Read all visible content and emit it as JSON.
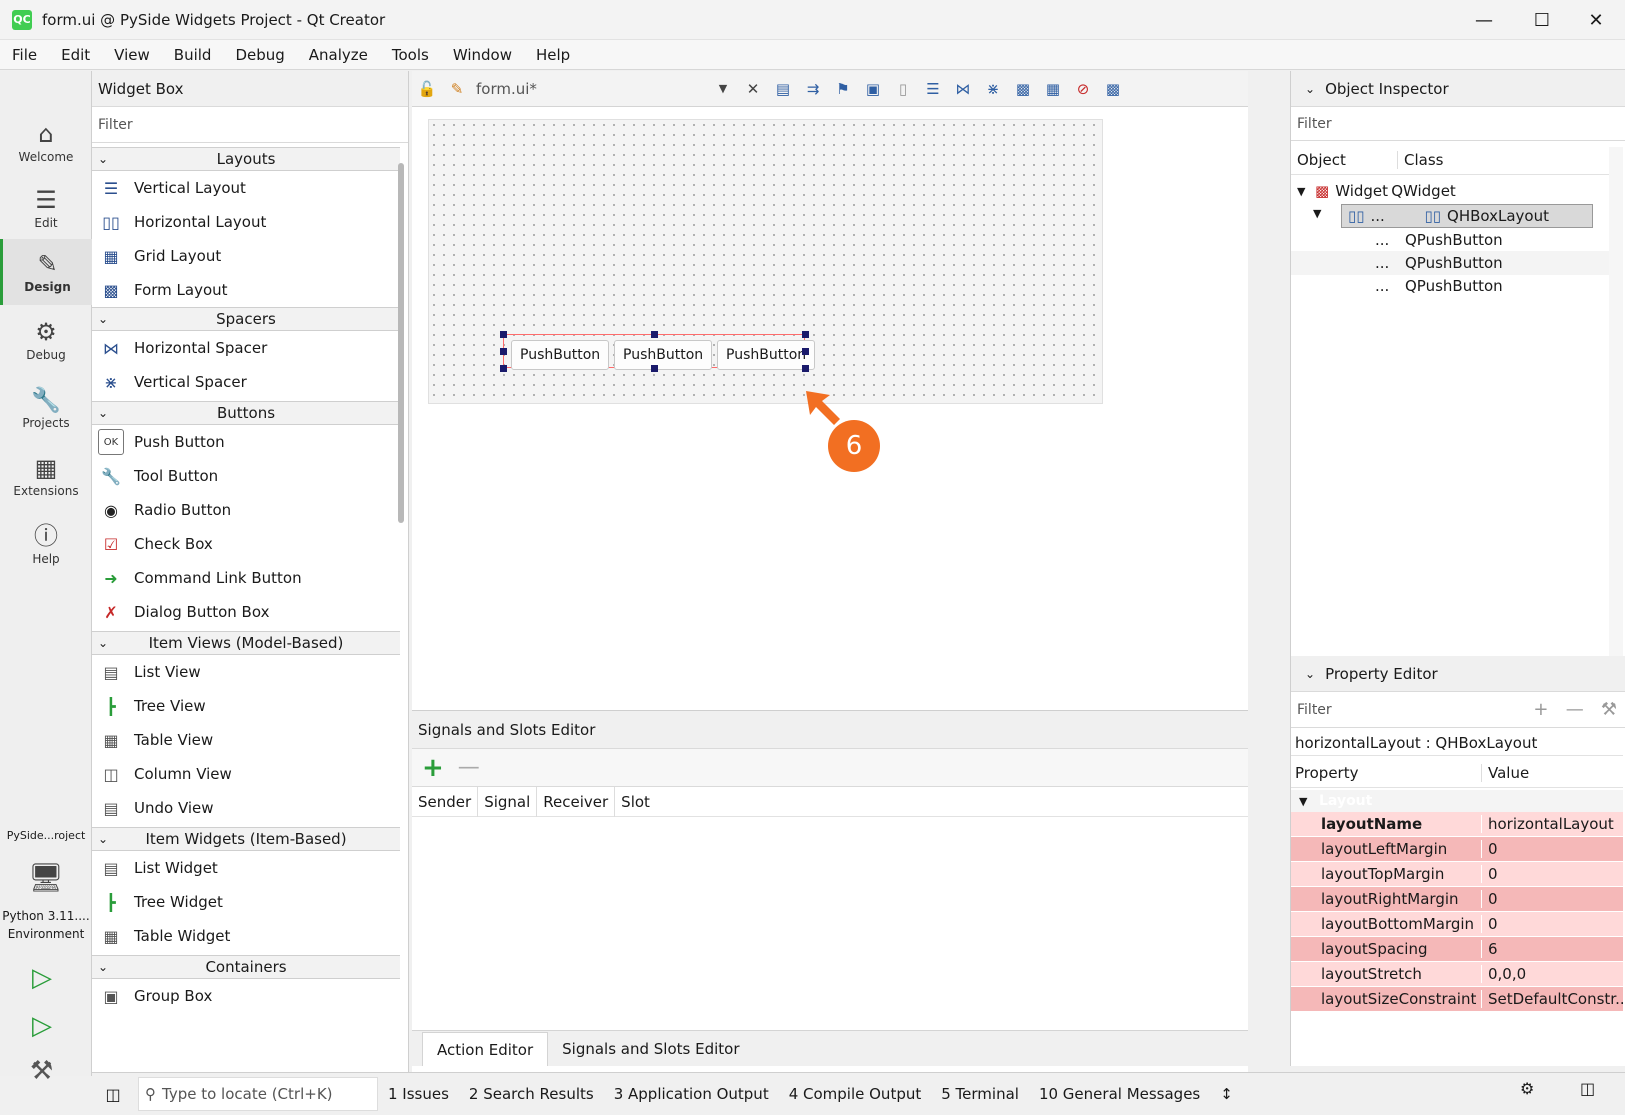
{
  "window": {
    "title": "form.ui @ PySide Widgets Project - Qt Creator",
    "app_icon": "QC"
  },
  "menu": [
    "File",
    "Edit",
    "View",
    "Build",
    "Debug",
    "Analyze",
    "Tools",
    "Window",
    "Help"
  ],
  "modes": [
    {
      "label": "Welcome",
      "icon": "home-icon"
    },
    {
      "label": "Edit",
      "icon": "edit-lines-icon"
    },
    {
      "label": "Design",
      "icon": "pen-icon",
      "active": true
    },
    {
      "label": "Debug",
      "icon": "bug-icon"
    },
    {
      "label": "Projects",
      "icon": "wrench-icon"
    },
    {
      "label": "Extensions",
      "icon": "extensions-icon"
    },
    {
      "label": "Help",
      "icon": "help-icon"
    }
  ],
  "project_selector": {
    "project": "PySide...roject",
    "env": "Python 3.11....",
    "env2": "Environment"
  },
  "widget_box": {
    "title": "Widget Box",
    "filter_placeholder": "Filter",
    "categories": {
      "layouts": "Layouts",
      "spacers": "Spacers",
      "buttons": "Buttons",
      "item_views": "Item Views (Model-Based)",
      "item_widgets": "Item Widgets (Item-Based)",
      "containers": "Containers"
    },
    "items": {
      "vertical_layout": "Vertical Layout",
      "horizontal_layout": "Horizontal Layout",
      "grid_layout": "Grid Layout",
      "form_layout": "Form Layout",
      "horizontal_spacer": "Horizontal Spacer",
      "vertical_spacer": "Vertical Spacer",
      "push_button": "Push Button",
      "tool_button": "Tool Button",
      "radio_button": "Radio Button",
      "check_box": "Check Box",
      "command_link_button": "Command Link Button",
      "dialog_button_box": "Dialog Button Box",
      "list_view": "List View",
      "tree_view": "Tree View",
      "table_view": "Table View",
      "column_view": "Column View",
      "undo_view": "Undo View",
      "list_widget": "List Widget",
      "tree_widget": "Tree Widget",
      "table_widget": "Table Widget",
      "group_box": "Group Box"
    }
  },
  "editor": {
    "file_name": "form.ui*",
    "buttons": [
      "PushButton",
      "PushButton",
      "PushButton"
    ],
    "callout": "6"
  },
  "signals_slots": {
    "title": "Signals and Slots Editor",
    "columns": [
      "Sender",
      "Signal",
      "Receiver",
      "Slot"
    ],
    "tabs": [
      "Action Editor",
      "Signals and Slots Editor"
    ]
  },
  "object_inspector": {
    "title": "Object Inspector",
    "filter_placeholder": "Filter",
    "col_object": "Object",
    "col_class": "Class",
    "rows": [
      {
        "object": "Widget",
        "class": "QWidget"
      },
      {
        "object": "...",
        "class": "QHBoxLayout"
      },
      {
        "object": "...",
        "class": "QPushButton"
      },
      {
        "object": "...",
        "class": "QPushButton"
      },
      {
        "object": "...",
        "class": "QPushButton"
      }
    ]
  },
  "property_editor": {
    "title": "Property Editor",
    "filter_placeholder": "Filter",
    "context": "horizontalLayout : QHBoxLayout",
    "col_property": "Property",
    "col_value": "Value",
    "group": "Layout",
    "rows": [
      {
        "name": "layoutName",
        "value": "horizontalLayout"
      },
      {
        "name": "layoutLeftMargin",
        "value": "0"
      },
      {
        "name": "layoutTopMargin",
        "value": "0"
      },
      {
        "name": "layoutRightMargin",
        "value": "0"
      },
      {
        "name": "layoutBottomMargin",
        "value": "0"
      },
      {
        "name": "layoutSpacing",
        "value": "6"
      },
      {
        "name": "layoutStretch",
        "value": "0,0,0"
      },
      {
        "name": "layoutSizeConstraint",
        "value": "SetDefaultConstr..."
      }
    ]
  },
  "statusbar": {
    "locate_placeholder": "Type to locate (Ctrl+K)",
    "items": [
      "1  Issues",
      "2  Search Results",
      "3  Application Output",
      "4  Compile Output",
      "5  Terminal",
      "10  General Messages"
    ]
  }
}
